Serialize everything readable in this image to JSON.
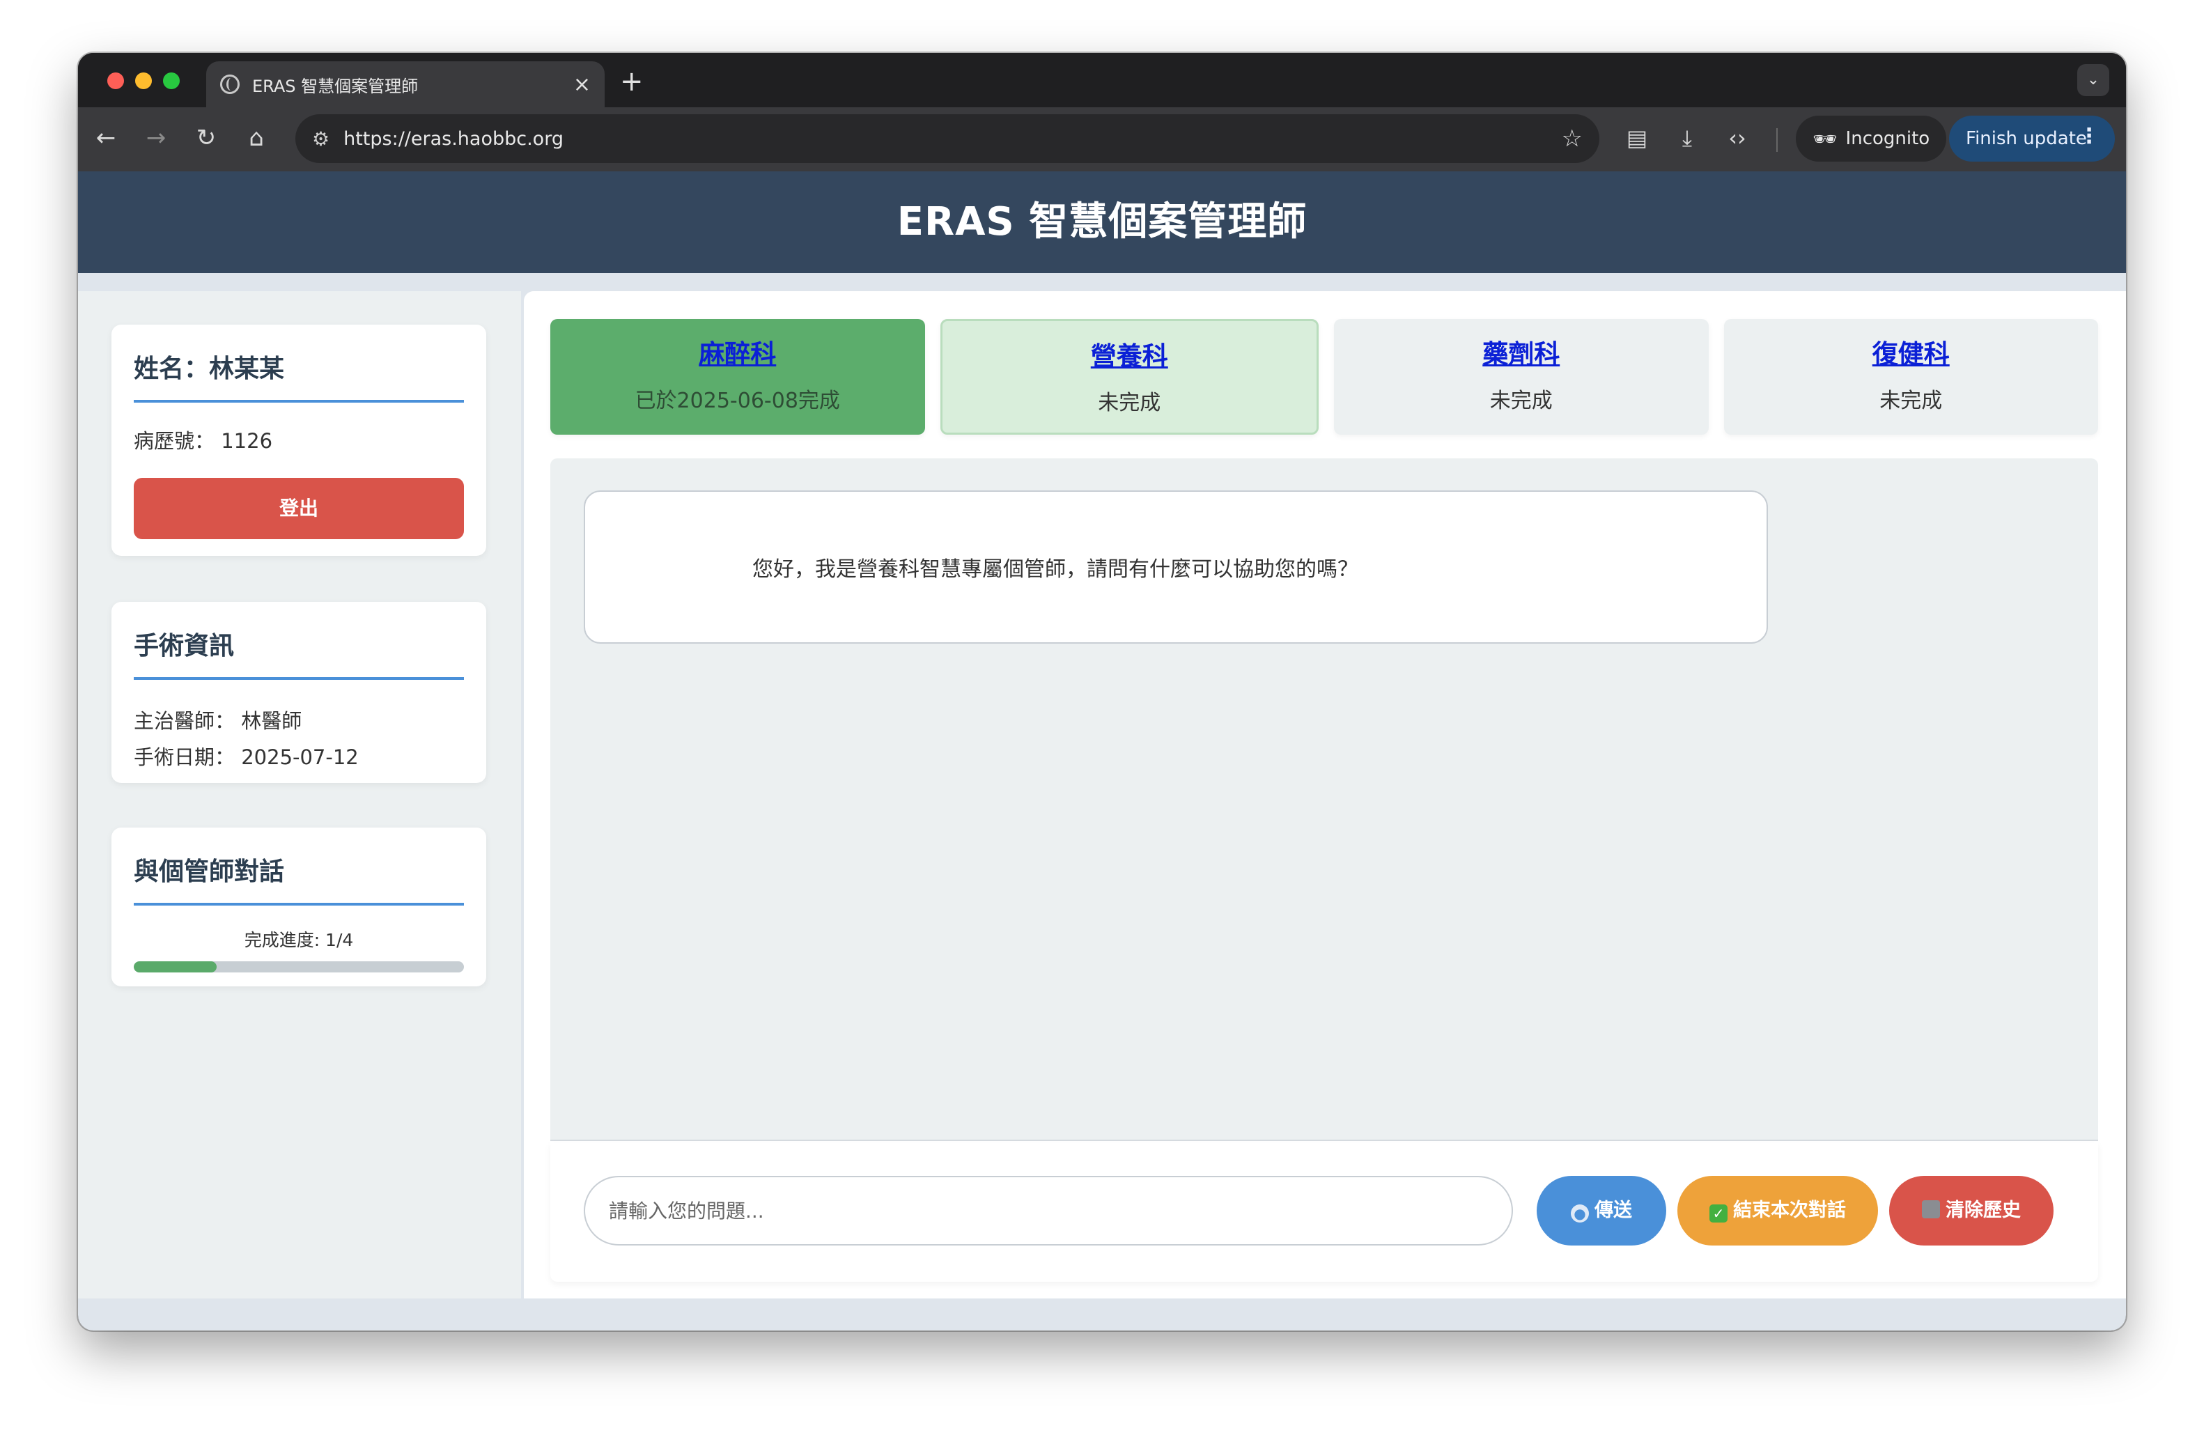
{
  "browser": {
    "tab_title": "ERAS 智慧個案管理師",
    "tab_close": "×",
    "new_tab": "+",
    "tab_menu": "⌄",
    "url": "https://eras.haobbc.org",
    "incognito_label": "Incognito",
    "finish_update_label": "Finish update",
    "nav": {
      "back": "←",
      "forward": "→",
      "reload": "↻",
      "home": "⌂"
    },
    "icons": [
      "tune-icon",
      "star-icon",
      "reading-list-icon",
      "download-icon",
      "devtools-icon",
      "incognito-icon",
      "more-icon"
    ]
  },
  "header": {
    "title": "ERAS 智慧個案管理師"
  },
  "patient": {
    "name_label": "姓名：林某某",
    "record_line": "病歷號： 1126",
    "logout_label": "登出"
  },
  "surgery": {
    "title": "手術資訊",
    "doctor_line": "主治醫師： 林醫師",
    "date_line": "手術日期： 2025-07-12"
  },
  "conversation": {
    "title": "與個管師對話",
    "progress_label": "完成進度: 1/4",
    "progress_fraction": 0.25
  },
  "departments": [
    {
      "name": "麻醉科",
      "status": "已於2025-06-08完成",
      "state": "done"
    },
    {
      "name": "營養科",
      "status": "未完成",
      "state": "active"
    },
    {
      "name": "藥劑科",
      "status": "未完成",
      "state": "pending"
    },
    {
      "name": "復健科",
      "status": "未完成",
      "state": "pending"
    }
  ],
  "chat": {
    "messages": [
      {
        "role": "assistant",
        "text": "您好，我是營養科智慧專屬個管師，請問有什麼可以協助您的嗎？"
      }
    ],
    "input_placeholder": "請輸入您的問題...",
    "send_label": "傳送",
    "end_label": "結束本次對話",
    "clear_label": "清除歷史"
  },
  "colors": {
    "header_bg": "#34475e",
    "done_tab": "#5cad6c",
    "active_tab": "#d9eedb",
    "send": "#4a90d9",
    "end": "#eea23a",
    "clear": "#d9544a",
    "link": "#0b20d6"
  }
}
